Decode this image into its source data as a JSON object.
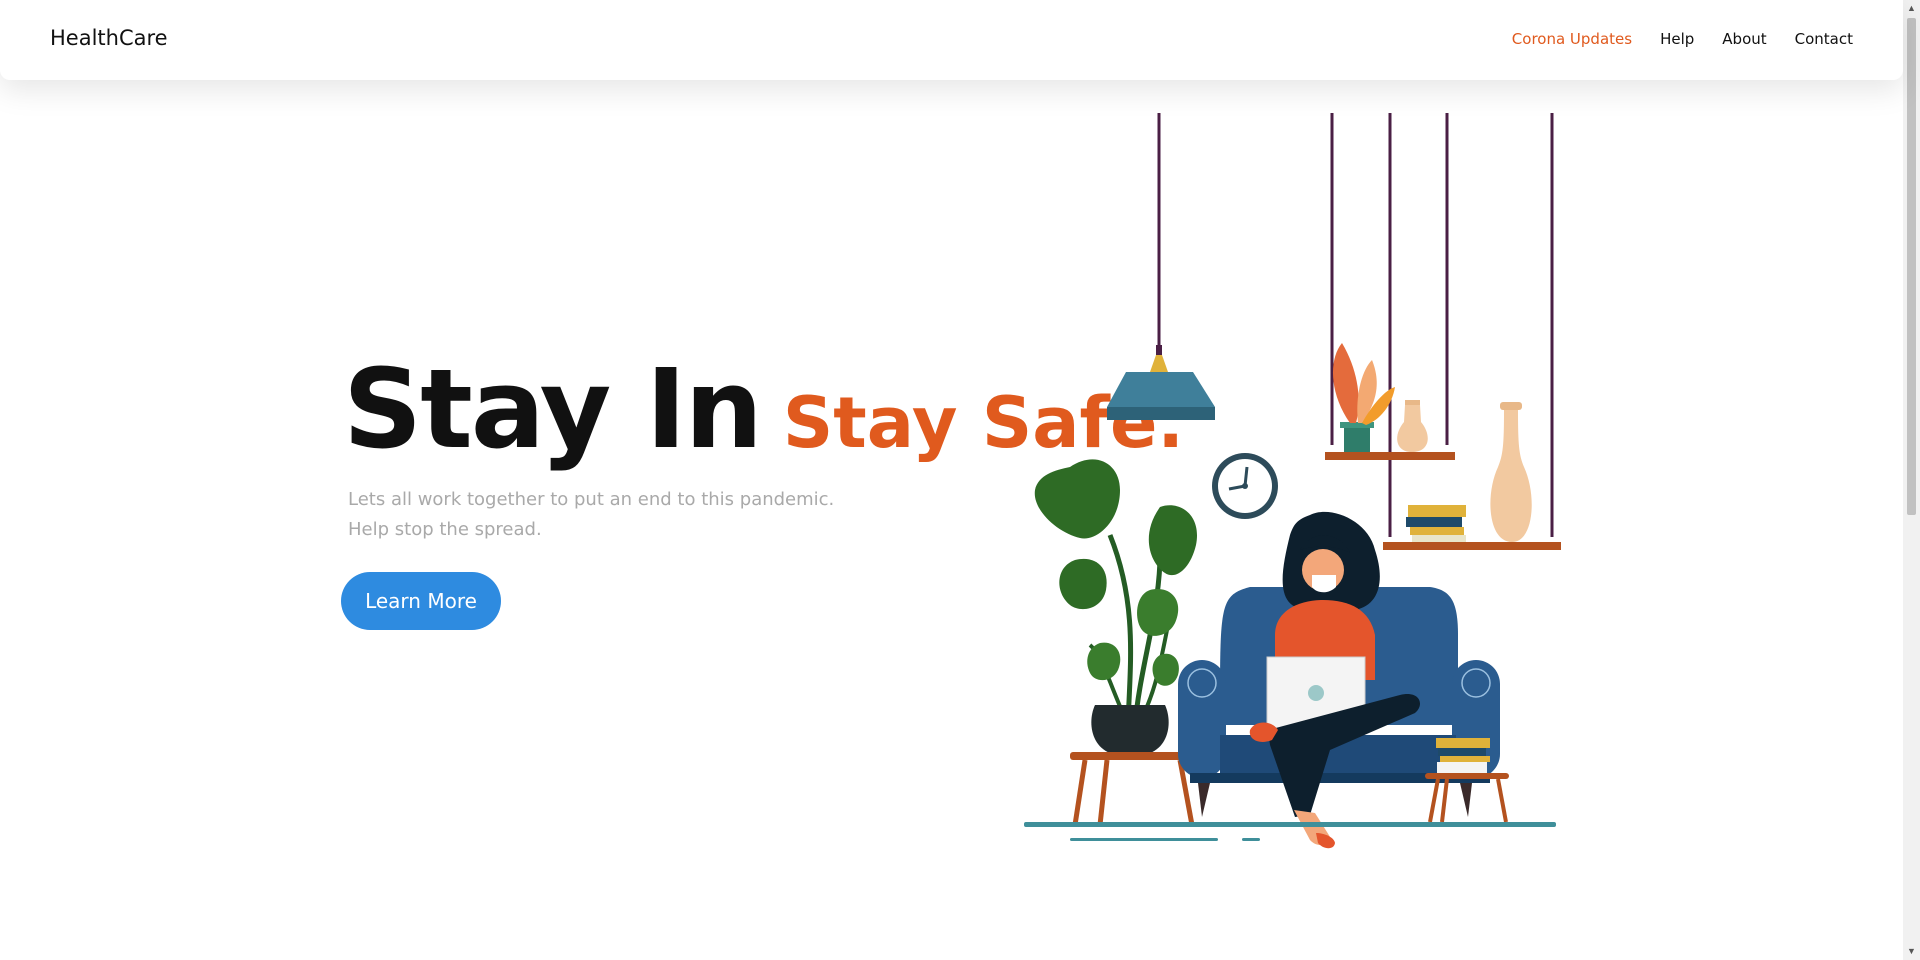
{
  "header": {
    "brand": "HealthCare",
    "nav": [
      {
        "label": "Corona Updates",
        "active": true
      },
      {
        "label": "Help"
      },
      {
        "label": "About"
      },
      {
        "label": "Contact"
      }
    ]
  },
  "hero": {
    "title_main": "Stay In",
    "title_accent": "Stay Safe.",
    "subtitle_line1": "Lets all work together to put an end to this pandemic.",
    "subtitle_line2": "Help stop the spread.",
    "cta_label": "Learn More"
  },
  "colors": {
    "accent": "#e05a1e",
    "button": "#2e8be0",
    "muted_text": "#a9a9a9"
  },
  "illustration": {
    "name": "woman-with-laptop-on-armchair-illustration"
  }
}
